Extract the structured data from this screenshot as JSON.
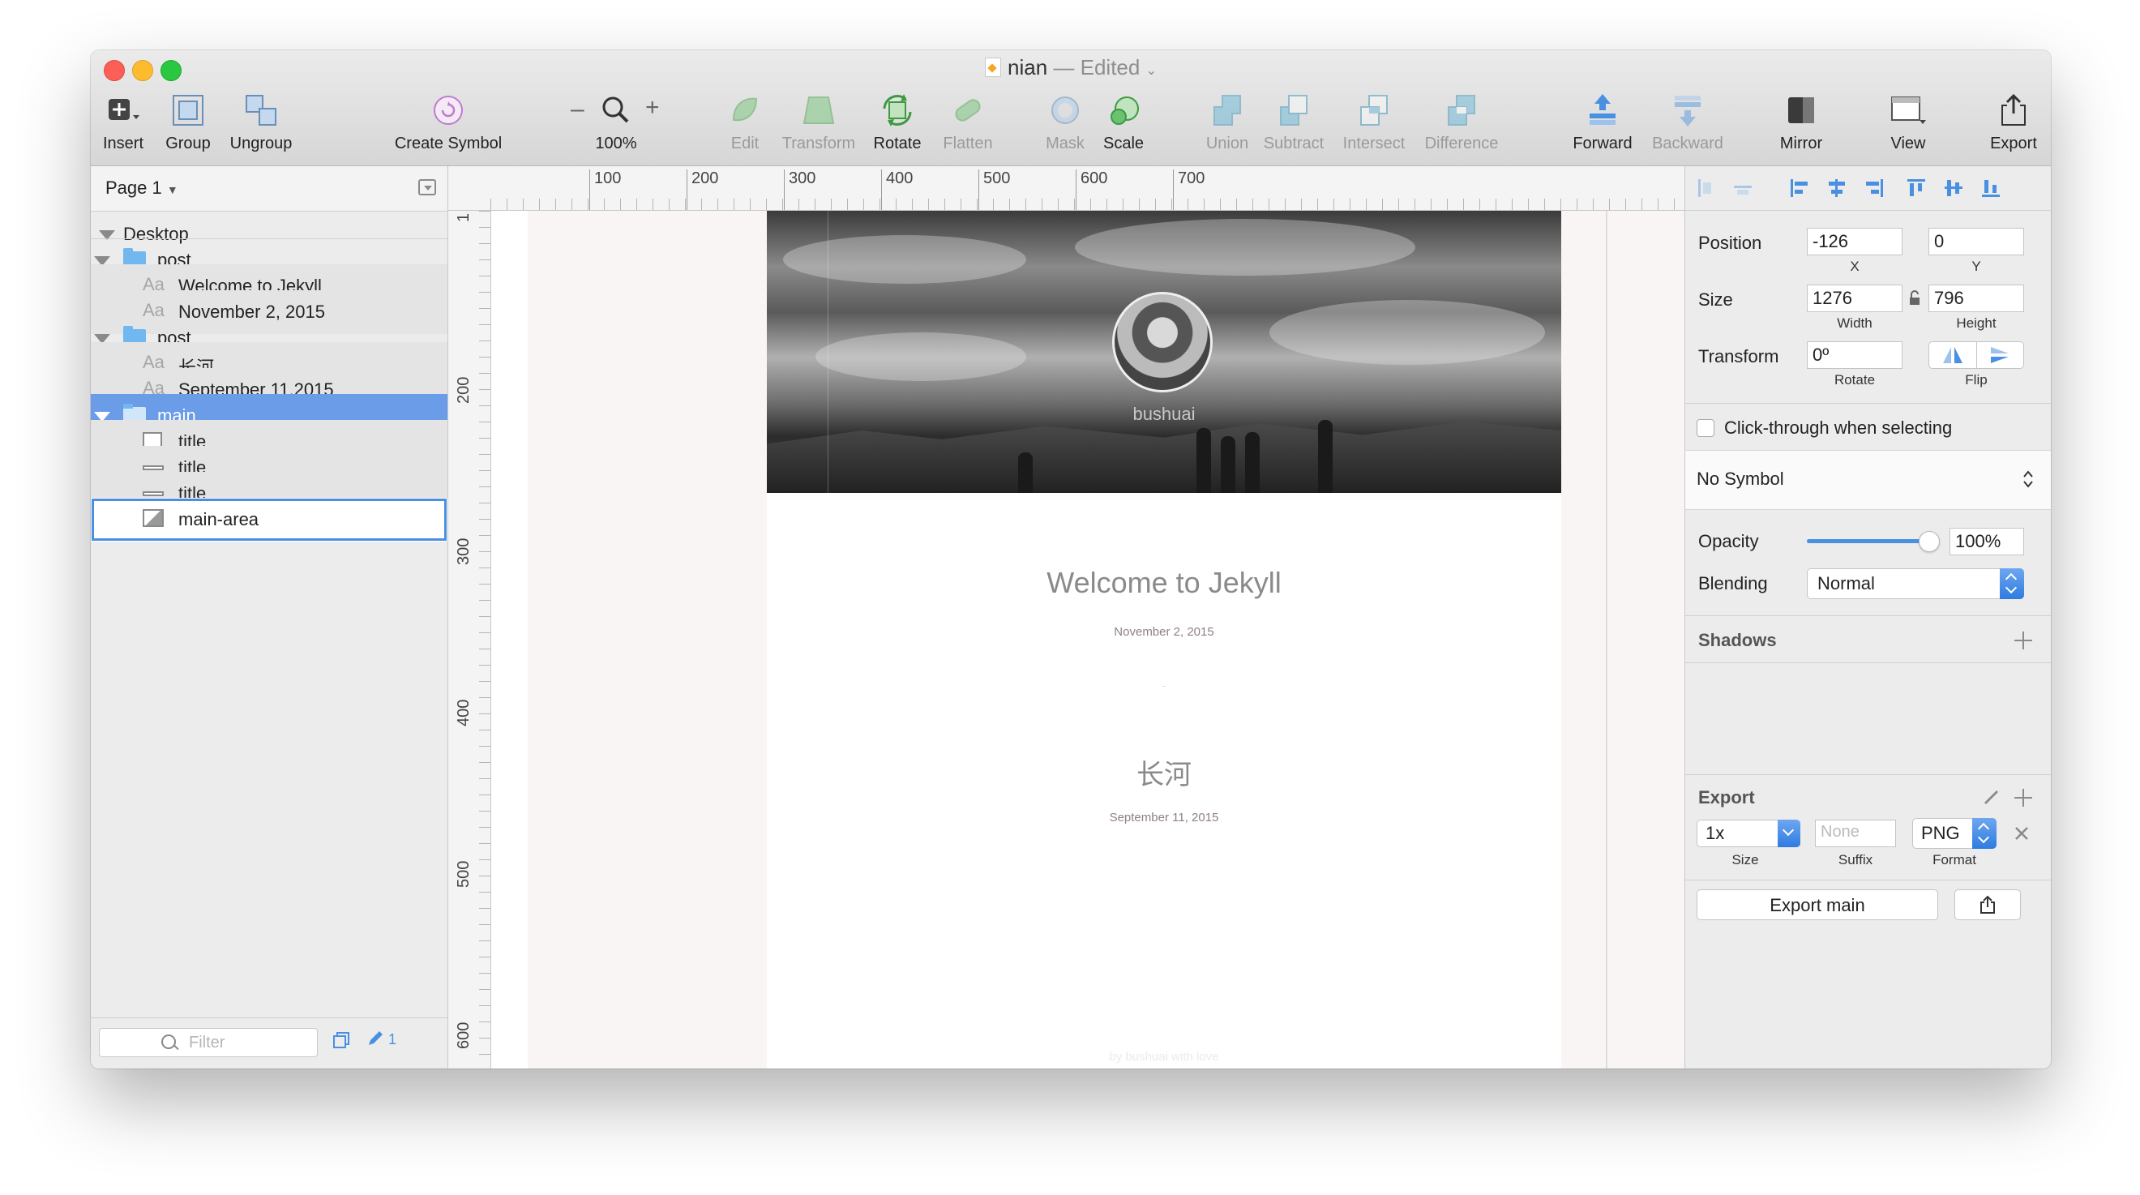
{
  "window": {
    "doc_name": "nian",
    "doc_state": "— Edited"
  },
  "toolbar": [
    {
      "id": "insert",
      "label": "Insert",
      "icon": "insert-plus-icon",
      "enabled": true
    },
    {
      "id": "group",
      "label": "Group",
      "icon": "group-icon",
      "enabled": true
    },
    {
      "id": "ungroup",
      "label": "Ungroup",
      "icon": "ungroup-icon",
      "enabled": true
    },
    {
      "id": "create-symbol",
      "label": "Create Symbol",
      "icon": "symbol-icon",
      "enabled": true
    },
    {
      "id": "zoom",
      "label": "100%",
      "icon": "magnifier-icon",
      "enabled": true
    },
    {
      "id": "edit",
      "label": "Edit",
      "icon": "edit-shape-icon",
      "enabled": false
    },
    {
      "id": "transform",
      "label": "Transform",
      "icon": "transform-icon",
      "enabled": false
    },
    {
      "id": "rotate",
      "label": "Rotate",
      "icon": "rotate-icon",
      "enabled": true
    },
    {
      "id": "flatten",
      "label": "Flatten",
      "icon": "flatten-icon",
      "enabled": false
    },
    {
      "id": "mask",
      "label": "Mask",
      "icon": "mask-icon",
      "enabled": false
    },
    {
      "id": "scale",
      "label": "Scale",
      "icon": "scale-icon",
      "enabled": true
    },
    {
      "id": "union",
      "label": "Union",
      "icon": "union-icon",
      "enabled": false
    },
    {
      "id": "subtract",
      "label": "Subtract",
      "icon": "subtract-icon",
      "enabled": false
    },
    {
      "id": "intersect",
      "label": "Intersect",
      "icon": "intersect-icon",
      "enabled": false
    },
    {
      "id": "difference",
      "label": "Difference",
      "icon": "difference-icon",
      "enabled": false
    },
    {
      "id": "forward",
      "label": "Forward",
      "icon": "forward-icon",
      "enabled": true
    },
    {
      "id": "backward",
      "label": "Backward",
      "icon": "backward-icon",
      "enabled": false
    },
    {
      "id": "mirror",
      "label": "Mirror",
      "icon": "mirror-icon",
      "enabled": true
    },
    {
      "id": "view",
      "label": "View",
      "icon": "view-icon",
      "enabled": true
    },
    {
      "id": "export",
      "label": "Export",
      "icon": "export-icon",
      "enabled": true
    }
  ],
  "zoom": {
    "minus": "–",
    "plus": "+"
  },
  "layers": {
    "page_label": "Page 1",
    "items": [
      {
        "label": "Desktop",
        "kind": "artboard"
      },
      {
        "label": "post",
        "kind": "folder"
      },
      {
        "label": "Welcome to Jekyll",
        "kind": "text",
        "prefix": "Aa"
      },
      {
        "label": "November 2, 2015",
        "kind": "text",
        "prefix": "Aa"
      },
      {
        "label": "post",
        "kind": "folder"
      },
      {
        "label": "长河",
        "kind": "text",
        "prefix": "Aa"
      },
      {
        "label": "September 11,2015",
        "kind": "text",
        "prefix": "Aa"
      },
      {
        "label": "main",
        "kind": "folder",
        "selected": true
      },
      {
        "label": "title",
        "kind": "rect"
      },
      {
        "label": "title",
        "kind": "line"
      },
      {
        "label": "title",
        "kind": "line"
      },
      {
        "label": "main-area",
        "kind": "image",
        "highlighted": true
      }
    ],
    "filter_placeholder": "Filter",
    "edit_count": "1"
  },
  "rulers": {
    "h": [
      "100",
      "200",
      "300",
      "400",
      "500",
      "600",
      "700"
    ],
    "v": [
      "1",
      "200",
      "300",
      "400",
      "500",
      "600"
    ]
  },
  "canvas": {
    "author": "bushuai",
    "posts": [
      {
        "title": "Welcome to Jekyll",
        "date": "November 2, 2015"
      },
      {
        "title": "长河",
        "date": "September 11, 2015"
      }
    ],
    "footer": "by bushuai with love"
  },
  "inspector": {
    "position": {
      "label": "Position",
      "x": "-126",
      "y": "0",
      "x_label": "X",
      "y_label": "Y"
    },
    "size": {
      "label": "Size",
      "width": "1276",
      "height": "796",
      "w_label": "Width",
      "h_label": "Height"
    },
    "transform": {
      "label": "Transform",
      "rotate": "0º",
      "rotate_label": "Rotate",
      "flip_label": "Flip"
    },
    "click_through": "Click-through when selecting",
    "symbol": "No Symbol",
    "opacity": {
      "label": "Opacity",
      "value": "100%",
      "level": 1.0
    },
    "blending": {
      "label": "Blending",
      "value": "Normal"
    },
    "shadows": "Shadows",
    "export": {
      "header": "Export",
      "size": "1x",
      "size_label": "Size",
      "suffix_placeholder": "None",
      "suffix_label": "Suffix",
      "format": "PNG",
      "format_label": "Format",
      "button": "Export main"
    }
  },
  "colors": {
    "selection": "#6b9ce8",
    "accent": "#4a90e2",
    "folder": "#71b7f0"
  }
}
